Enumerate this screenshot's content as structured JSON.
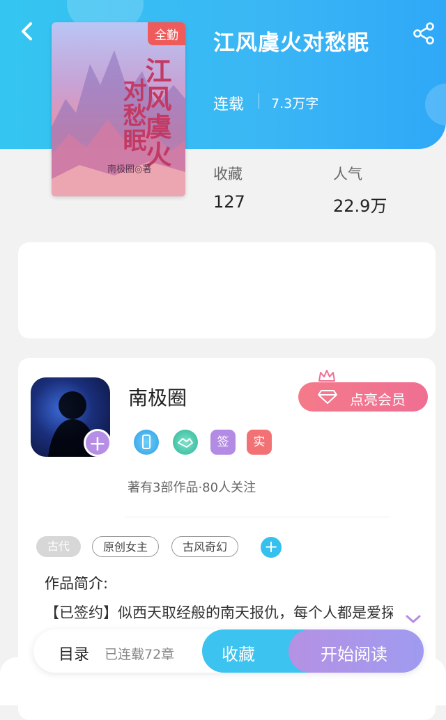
{
  "header": {
    "title": "江风虞火对愁眠",
    "status": "连载",
    "word_count": "7.3万字",
    "cover": {
      "badge": "全勤",
      "title_line1": "江风虞火",
      "title_line2": "对愁眠",
      "author_mark": "南极圈◎著"
    }
  },
  "stats": {
    "favorites_label": "收藏",
    "favorites_value": "127",
    "popularity_label": "人气",
    "popularity_value": "22.9万"
  },
  "author": {
    "name": "南极圈",
    "vip_button": "点亮会员",
    "badges": [
      {
        "name": "phone-badge-icon",
        "text": ""
      },
      {
        "name": "handshake-badge-icon",
        "text": ""
      },
      {
        "name": "signed-badge",
        "text": "签"
      },
      {
        "name": "verified-badge",
        "text": "实"
      }
    ],
    "meta": "著有3部作品·80人关注"
  },
  "tags": [
    "古代",
    "原创女主",
    "古风奇幻"
  ],
  "intro": {
    "label": "作品简介:",
    "text": "【已签约】似西天取经般的南天报仇，每个人都是爱探险的朵拉，报仇小分队不断壮大，二人，四人……"
  },
  "bottom_bar": {
    "toc_label": "目录",
    "toc_count": "已连载72章",
    "favorite_button": "收藏",
    "read_button": "开始阅读"
  },
  "colors": {
    "accent": "#3ab6f5",
    "vip": "#f0738f",
    "read": "#a998ec"
  }
}
